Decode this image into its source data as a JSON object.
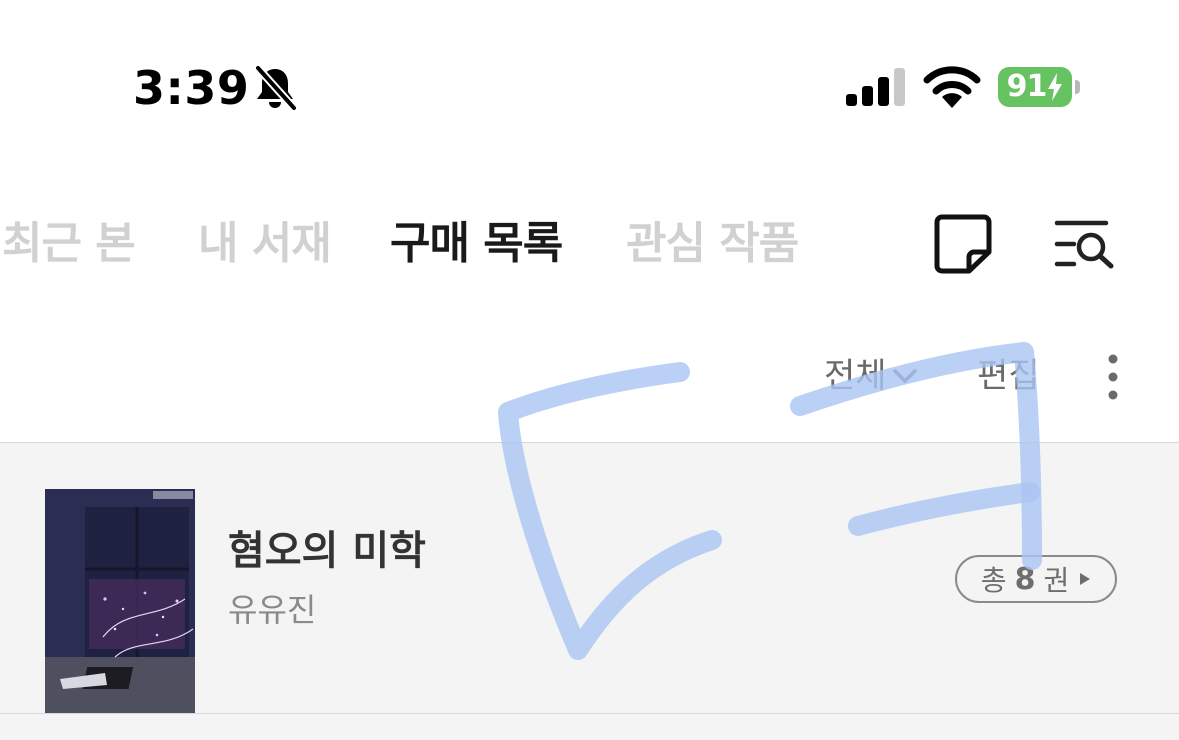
{
  "status_bar": {
    "time": "3:39",
    "battery_level": "91",
    "icons": [
      "bell-off-icon",
      "cellular-signal-icon",
      "wifi-icon",
      "battery-charging-icon"
    ],
    "battery_color": "#67c262"
  },
  "tabs": [
    {
      "label": "최근 본",
      "active": false
    },
    {
      "label": "내 서재",
      "active": false
    },
    {
      "label": "구매 목록",
      "active": true
    },
    {
      "label": "관심 작품",
      "active": false
    }
  ],
  "header_icons": [
    "memo-icon",
    "search-list-icon"
  ],
  "filter": {
    "selected": "전체",
    "edit_label": "편집"
  },
  "books": [
    {
      "title": "혐오의 미학",
      "author": "유유진",
      "volumes_prefix": "총",
      "volumes_count": "8",
      "volumes_suffix": "권"
    }
  ],
  "colors": {
    "active_tab": "#1a1a1a",
    "inactive_tab": "#d1d1d1",
    "list_background": "#f4f4f4",
    "scribble": "#aac4f2"
  }
}
